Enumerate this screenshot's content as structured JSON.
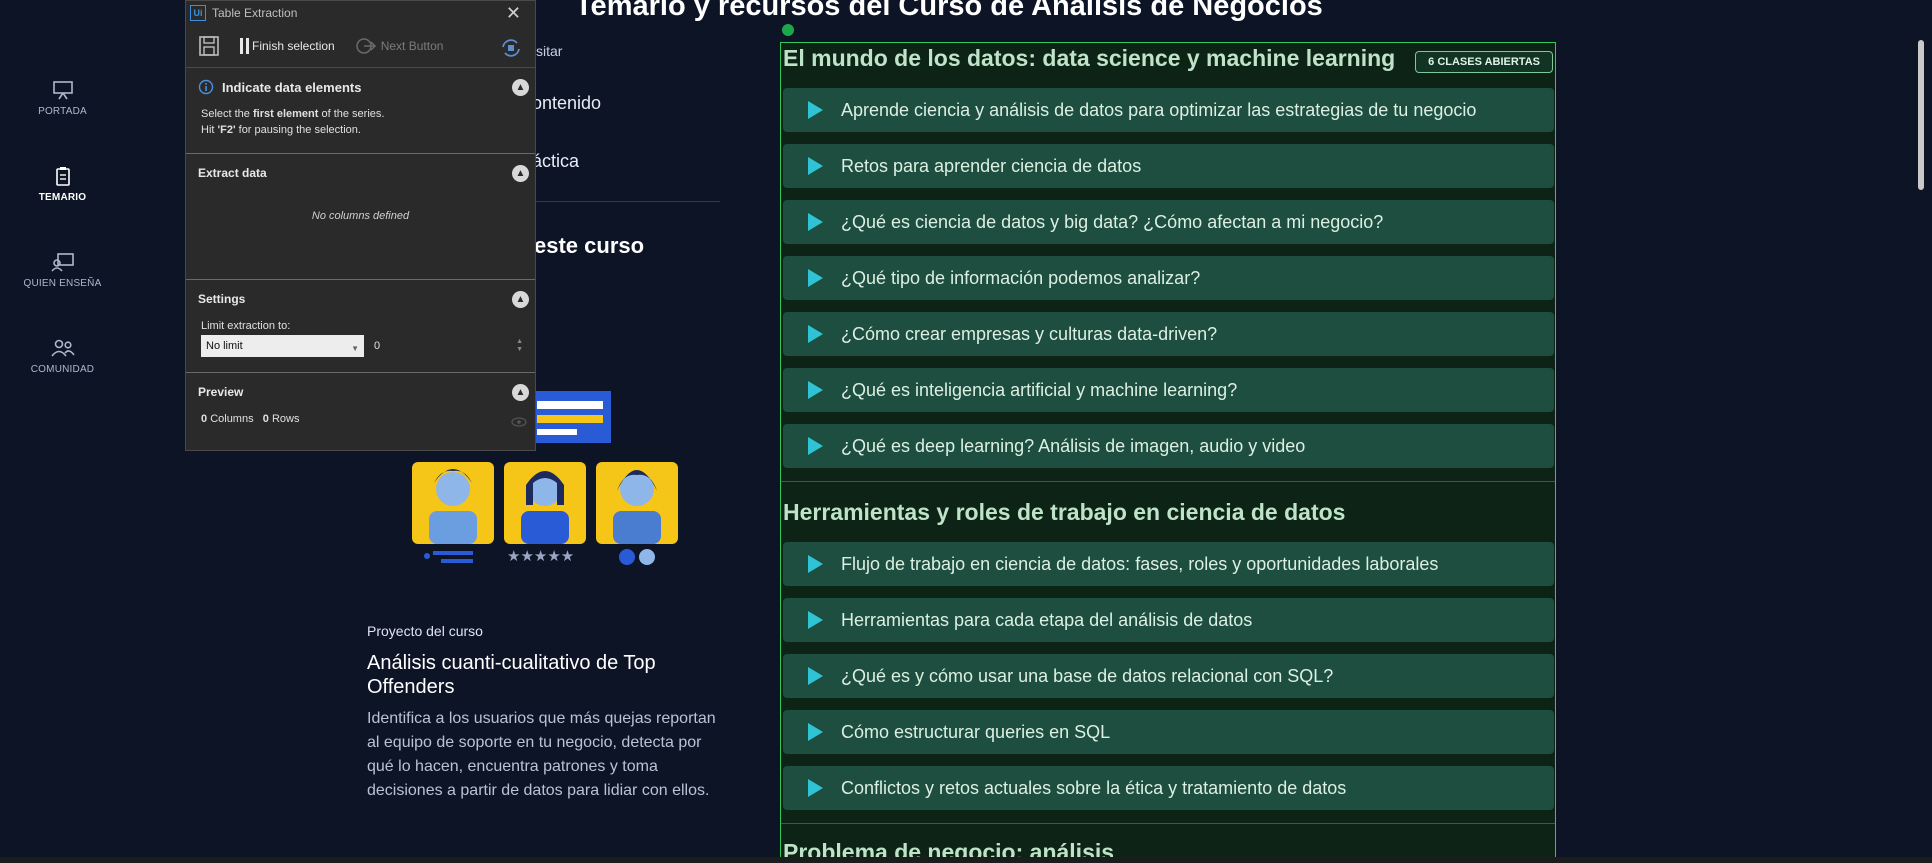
{
  "page": {
    "title": "Temario y recursos del Curso de Análisis de Negocios"
  },
  "leftnav": {
    "items": [
      {
        "label": "PORTADA",
        "icon": "presentation-icon"
      },
      {
        "label": "TEMARIO",
        "icon": "clipboard-icon",
        "active": true
      },
      {
        "label": "QUIEN ENSEÑA",
        "icon": "teacher-icon"
      },
      {
        "label": "COMUNIDAD",
        "icon": "people-icon"
      }
    ]
  },
  "behind": {
    "frag1": "sitar",
    "frag2": "ontenido",
    "frag3": "áctica",
    "frag4": "este curso"
  },
  "project": {
    "kicker": "Proyecto del curso",
    "title": "Análisis cuanti-cualitativo de Top Offenders",
    "description": "Identifica a los usuarios que más quejas reportan al equipo de soporte en tu negocio, detecta por qué lo hacen, encuentra patrones y toma decisiones a partir de datos para lidiar con ellos."
  },
  "dialog": {
    "badge": "Ui",
    "title": "Table Extraction",
    "toolbar": {
      "finish": "Finish selection",
      "next": "Next Button"
    },
    "indicate": {
      "title": "Indicate data elements",
      "line1_a": "Select the ",
      "line1_b": "first element",
      "line1_c": " of the series.",
      "line2_a": "Hit ",
      "line2_b": "'F2'",
      "line2_c": " for pausing the selection."
    },
    "extract": {
      "title": "Extract data",
      "empty": "No columns defined"
    },
    "settings": {
      "title": "Settings",
      "limit_label": "Limit extraction to:",
      "limit_value": "No limit",
      "limit_number": "0"
    },
    "preview": {
      "title": "Preview",
      "columns_count": "0",
      "columns_label": "Columns",
      "rows_count": "0",
      "rows_label": "Rows"
    }
  },
  "course": {
    "badge": "6 CLASES ABIERTAS",
    "sections": [
      {
        "title": "El mundo de los datos: data science y machine learning",
        "lessons": [
          "Aprende ciencia y análisis de datos para optimizar las estrategias de tu negocio",
          "Retos para aprender ciencia de datos",
          "¿Qué es ciencia de datos y big data? ¿Cómo afectan a mi negocio?",
          "¿Qué tipo de información podemos analizar?",
          "¿Cómo crear empresas y culturas data-driven?",
          "¿Qué es inteligencia artificial y machine learning?",
          "¿Qué es deep learning? Análisis de imagen, audio y video"
        ]
      },
      {
        "title": "Herramientas y roles de trabajo en ciencia de datos",
        "lessons": [
          "Flujo de trabajo en ciencia de datos: fases, roles y oportunidades laborales",
          "Herramientas para cada etapa del análisis de datos",
          "¿Qué es y cómo usar una base de datos relacional con SQL?",
          "Cómo estructurar queries en SQL",
          "Conflictos y retos actuales sobre la ética y tratamiento de datos"
        ]
      },
      {
        "title": "Problema de negocio: análisis"
      }
    ]
  },
  "colors": {
    "background": "#0c1426",
    "course_bg": "#0c2316",
    "lesson_bg": "#1d4e3f",
    "play": "#2ec4d6",
    "outline": "#34c759"
  }
}
